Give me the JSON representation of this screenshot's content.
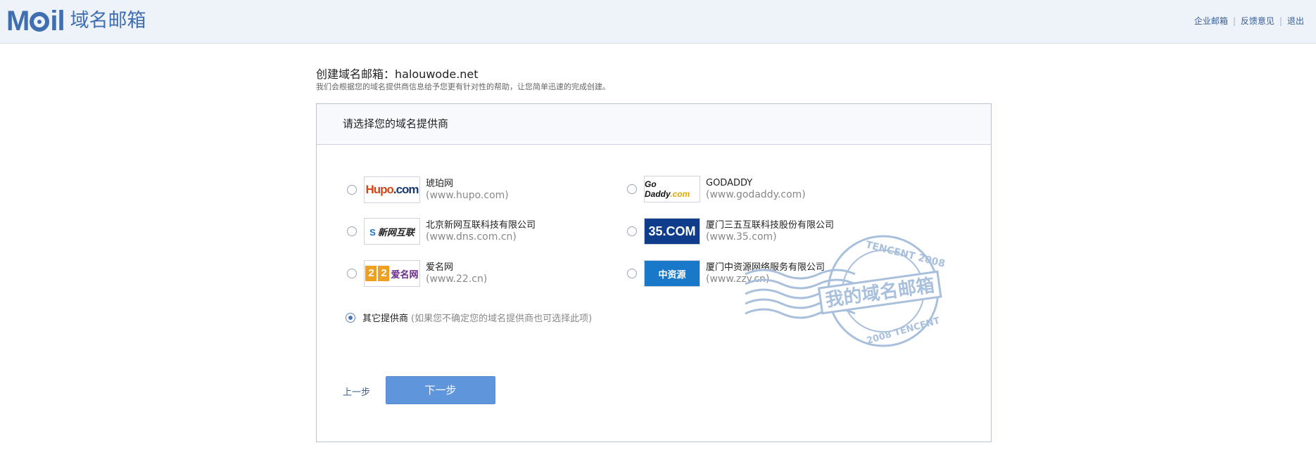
{
  "header": {
    "logo_mark": "MOil",
    "logo_text": "域名邮箱",
    "links": [
      "企业邮箱",
      "反馈意见",
      "退出"
    ]
  },
  "page": {
    "title": "创建域名邮箱：halouwode.net",
    "subtitle": "我们会根据您的域名提供商信息给予您更有针对性的帮助，让您简单迅速的完成创建。"
  },
  "panel": {
    "title": "请选择您的域名提供商",
    "providers": [
      {
        "name": "琥珀网",
        "url": "(www.hupo.com)",
        "logo": "Hupo.com",
        "selected": false
      },
      {
        "name": "GODADDY",
        "url": "(www.godaddy.com)",
        "logo": "Go Daddy.com",
        "selected": false
      },
      {
        "name": "北京新网互联科技有限公司",
        "url": "(www.dns.com.cn)",
        "logo": "新网互联",
        "selected": false
      },
      {
        "name": "厦门三五互联科技股份有限公司",
        "url": "(www.35.com)",
        "logo": "35.COM",
        "selected": false
      },
      {
        "name": "爱名网",
        "url": "(www.22.cn)",
        "logo": "22 爱名网",
        "selected": false
      },
      {
        "name": "厦门中资源网络服务有限公司",
        "url": "(www.zzy.cn)",
        "logo": "中资源",
        "selected": false
      }
    ],
    "other": {
      "label": "其它提供商",
      "hint": "(如果您不确定您的域名提供商也可选择此项)",
      "selected": true
    },
    "stamp": {
      "text": "我的域名邮箱",
      "ring_top": "TENCENT 2008",
      "ring_bottom": "2008 TENCENT"
    },
    "prev_label": "上一步",
    "next_label": "下一步"
  },
  "colors": {
    "brand": "#3f6eb1",
    "primary_button": "#5f95db",
    "link": "#3a5f94",
    "stamp": "#a9c0dd"
  }
}
